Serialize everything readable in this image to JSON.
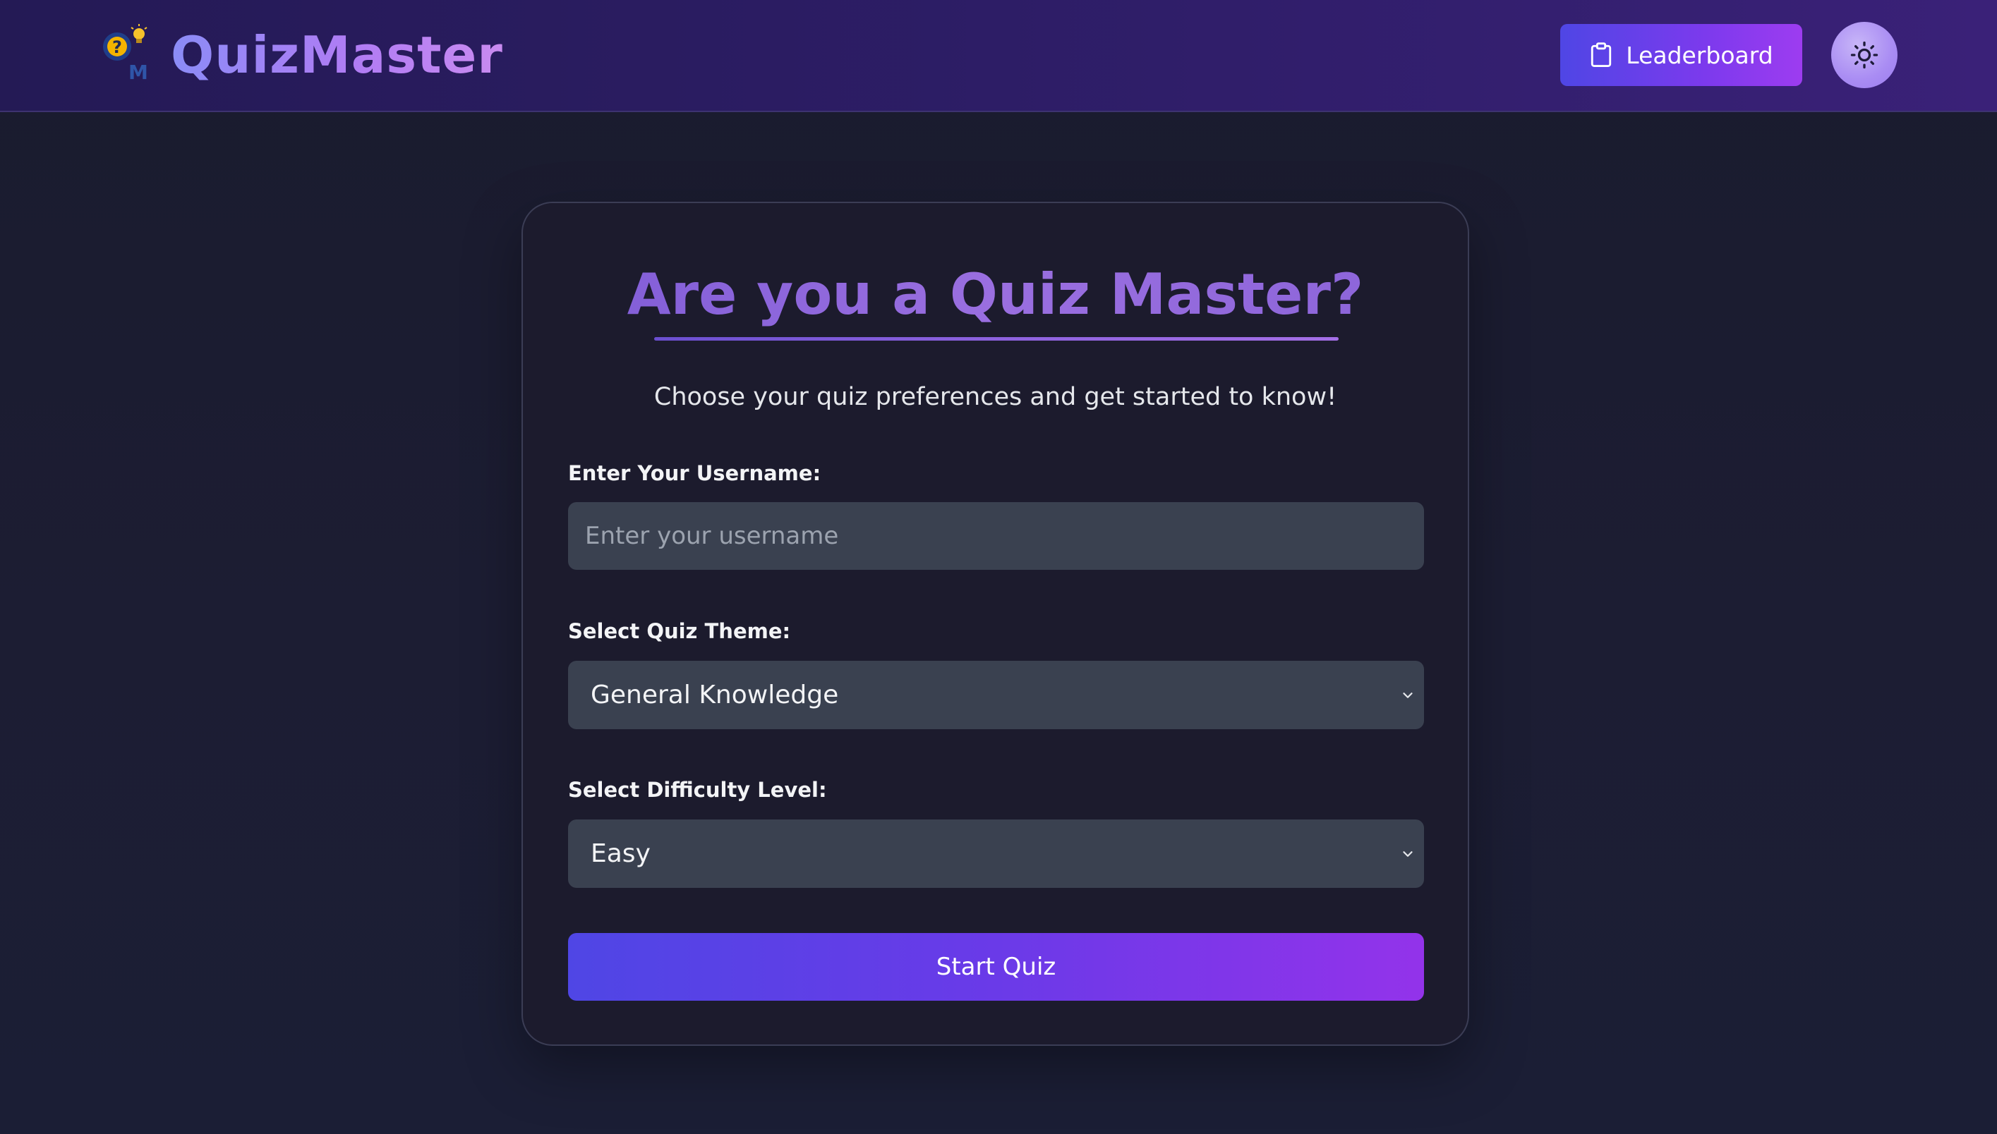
{
  "header": {
    "brand": "QuizMaster",
    "logo_icon": "quiz-master-logo-icon",
    "leaderboard_label": "Leaderboard",
    "leaderboard_icon": "clipboard-icon",
    "theme_toggle_icon": "sun-icon"
  },
  "card": {
    "title": "Are you a Quiz Master?",
    "subtitle": "Choose your quiz preferences and get started to know!",
    "username": {
      "label": "Enter Your Username:",
      "placeholder": "Enter your username",
      "value": ""
    },
    "theme": {
      "label": "Select Quiz Theme:",
      "selected": "General Knowledge"
    },
    "difficulty": {
      "label": "Select Difficulty Level:",
      "selected": "Easy"
    },
    "start_label": "Start Quiz"
  },
  "colors": {
    "background": "#1a1b2e",
    "header": "#2d1d66",
    "accent_start": "#4f46e5",
    "accent_end": "#9333ea",
    "title": "#8a63d8",
    "field": "#3a4150"
  }
}
